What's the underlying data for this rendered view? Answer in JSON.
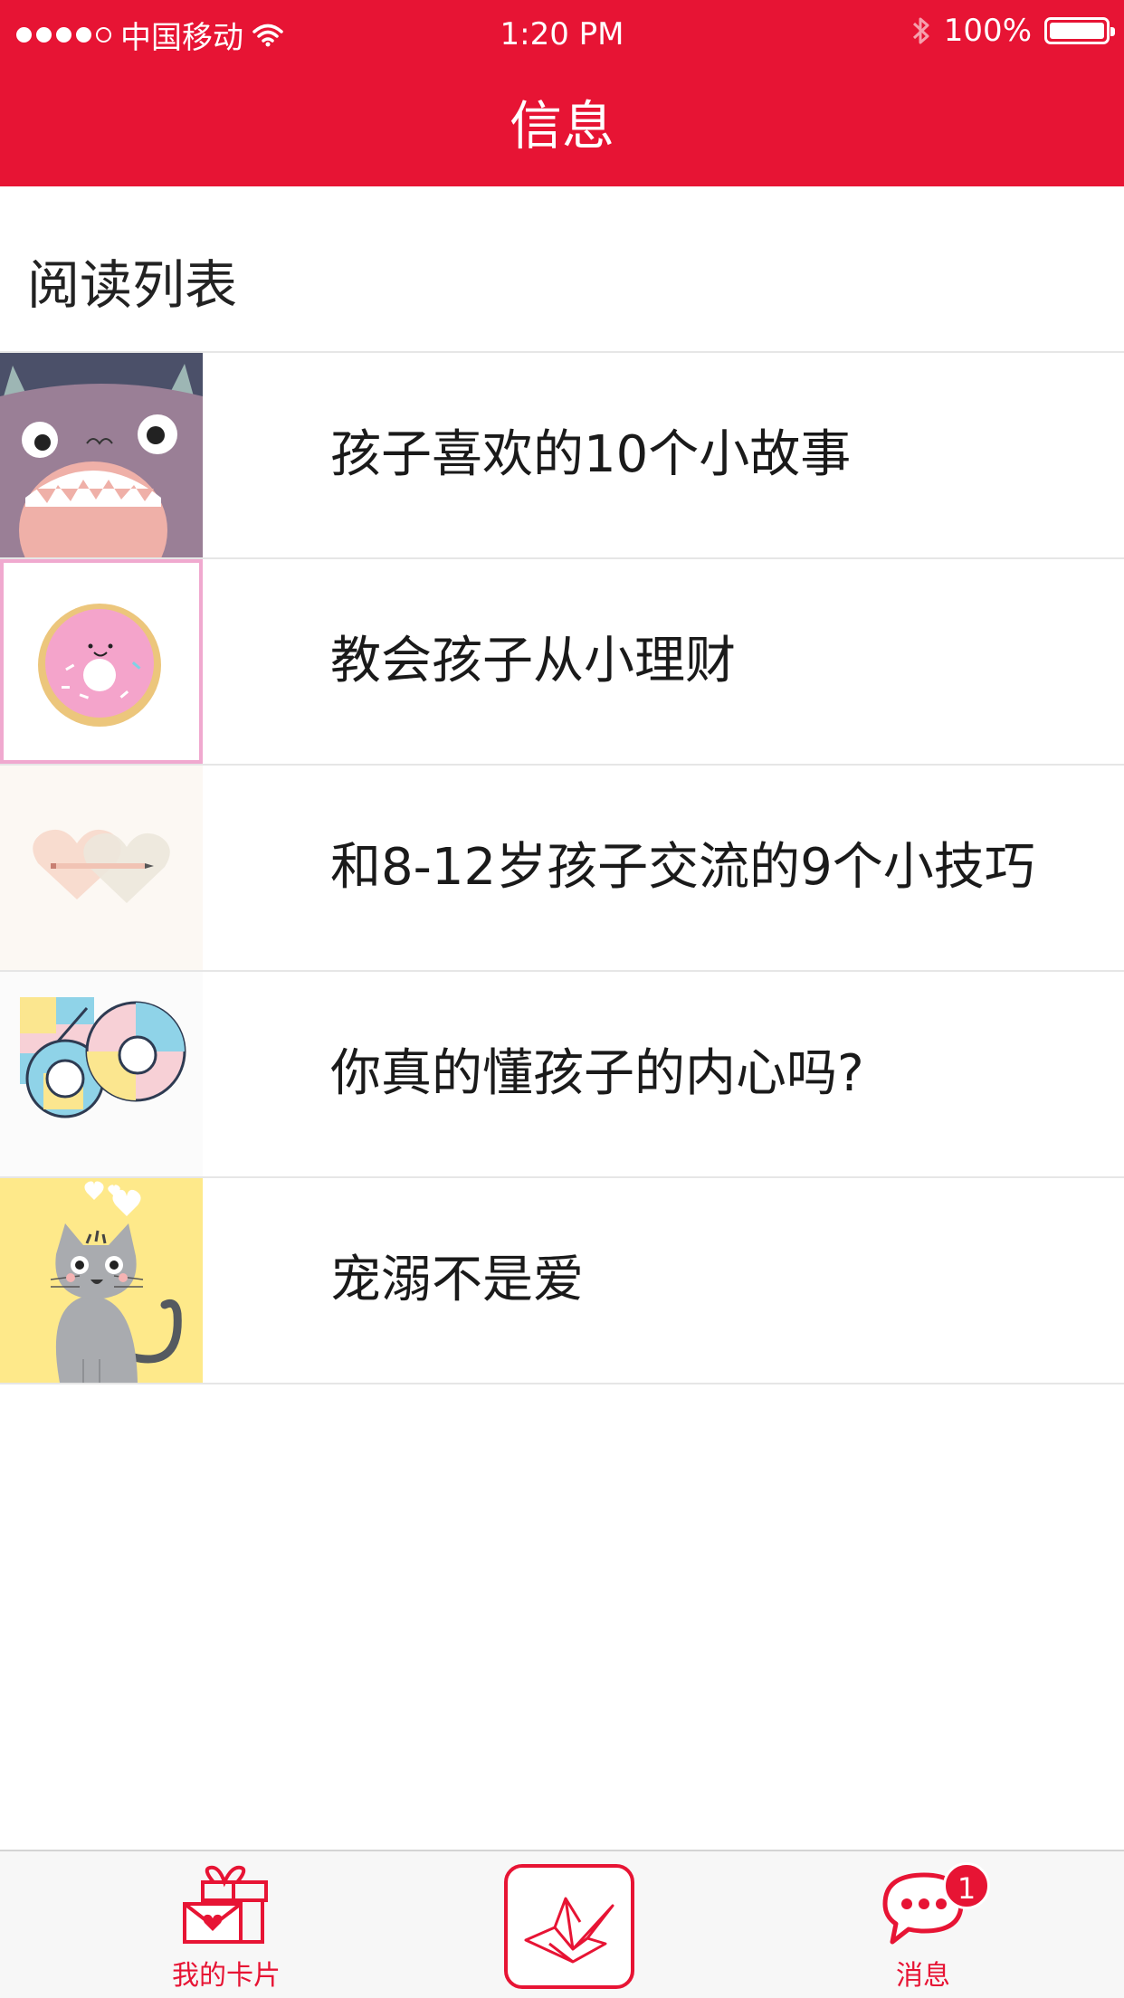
{
  "status_bar": {
    "carrier": "中国移动",
    "time": "1:20 PM",
    "battery": "100%"
  },
  "nav": {
    "title": "信息"
  },
  "section": {
    "title": "阅读列表"
  },
  "articles": [
    {
      "title": "孩子喜欢的10个小故事",
      "thumbnail_icon": "monster-icon"
    },
    {
      "title": "教会孩子从小理财",
      "thumbnail_icon": "donut-icon"
    },
    {
      "title": "和8-12岁孩子交流的9个小技巧",
      "thumbnail_icon": "hearts-pencil-icon"
    },
    {
      "title": "你真的懂孩子的内心吗?",
      "thumbnail_icon": "geometric-pattern-icon"
    },
    {
      "title": "宠溺不是爱",
      "thumbnail_icon": "cat-icon"
    }
  ],
  "tabbar": {
    "tabs": [
      {
        "label": "我的卡片",
        "icon": "gift-card-icon"
      },
      {
        "label": "",
        "icon": "paper-crane-icon"
      },
      {
        "label": "消息",
        "icon": "chat-bubble-icon",
        "badge": "1"
      }
    ]
  },
  "colors": {
    "brand": "#e71434"
  }
}
